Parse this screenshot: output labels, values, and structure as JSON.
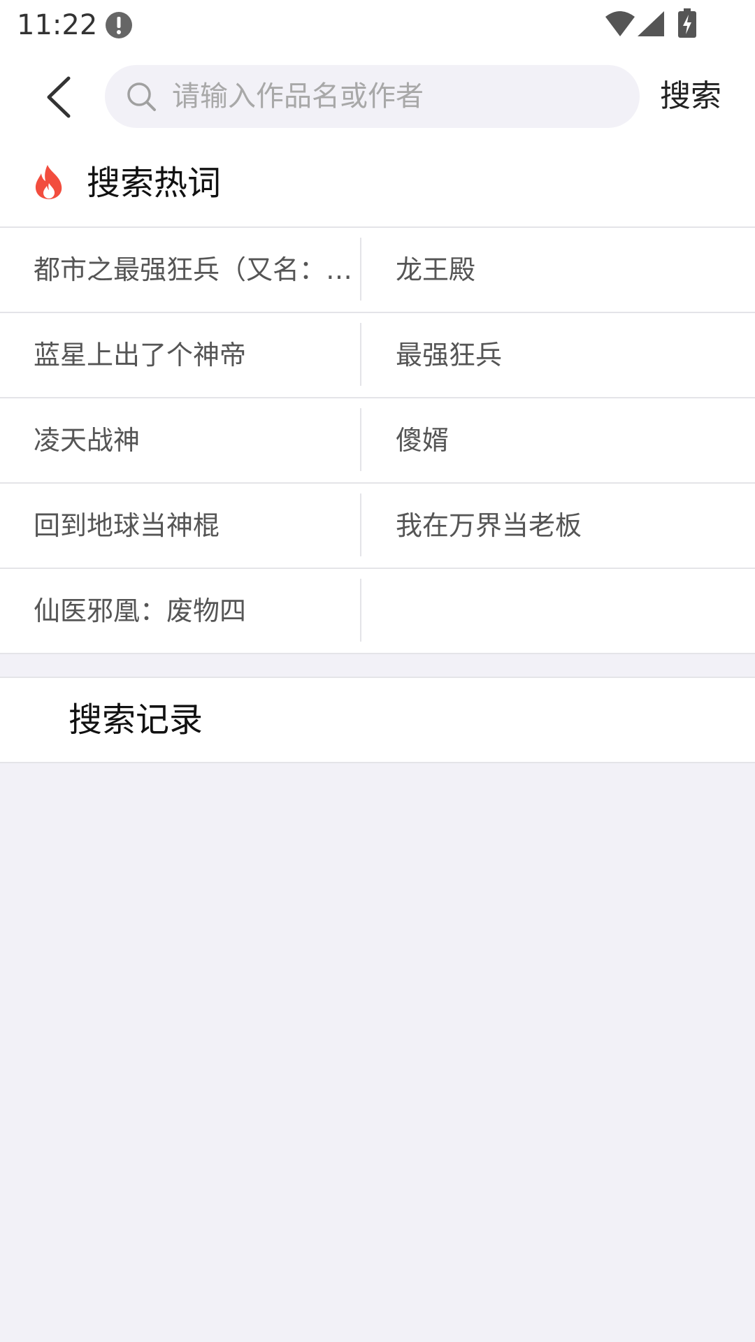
{
  "status_bar": {
    "time": "11:22"
  },
  "search_header": {
    "placeholder": "请输入作品名或作者",
    "value": "",
    "submit_label": "搜索"
  },
  "hot_words": {
    "title": "搜索热词",
    "accent_color": "#f24d3e",
    "items": [
      "都市之最强狂兵（又名：…",
      "龙王殿",
      "蓝星上出了个神帝",
      "最强狂兵",
      "凌天战神",
      "傻婿",
      "回到地球当神棍",
      "我在万界当老板",
      "仙医邪凰：废物四",
      ""
    ]
  },
  "history": {
    "title": "搜索记录"
  },
  "icons": {
    "status": [
      "alert-icon",
      "wifi-icon",
      "signal-icon",
      "battery-charging-icon"
    ],
    "header": [
      "back-arrow-icon",
      "search-icon"
    ],
    "section": [
      "fire-icon"
    ]
  }
}
